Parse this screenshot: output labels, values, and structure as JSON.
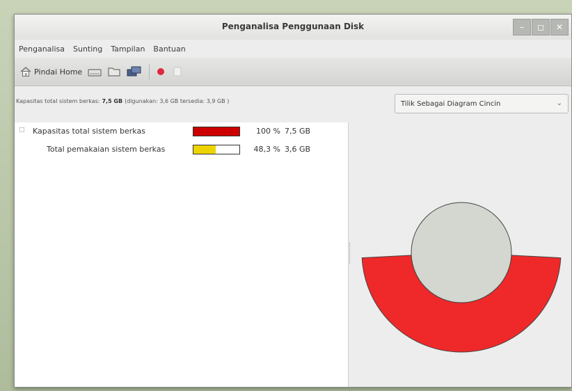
{
  "window": {
    "title": "Penganalisa Penggunaan Disk"
  },
  "wm": {
    "minimize": "–",
    "maximize": "◻",
    "close": "✕"
  },
  "menubar": {
    "items": [
      "Penganalisa",
      "Sunting",
      "Tampilan",
      "Bantuan"
    ]
  },
  "toolbar": {
    "home_label": "Pindai Home"
  },
  "infobar": {
    "prefix": "Kapasitas total sistem berkas:",
    "total": "7,5 GB",
    "suffix": "(digunakan: 3,6 GB tersedia: 3,9 GB )"
  },
  "view_select": {
    "value": "Tilik Sebagai Diagram Cincin"
  },
  "tree": {
    "rows": [
      {
        "label": "Kapasitas total sistem berkas",
        "percent": "100 %",
        "size": "7,5 GB",
        "fill": 1.0,
        "color": "#cc0000"
      },
      {
        "label": "Total pemakaian sistem berkas",
        "percent": "48,3 %",
        "size": "3,6 GB",
        "fill": 0.483,
        "color": "#edd400"
      }
    ]
  },
  "ring_chart": {
    "used_fraction": 0.483,
    "ring_color": "#ef2929",
    "center_color": "#d3d7cf"
  }
}
